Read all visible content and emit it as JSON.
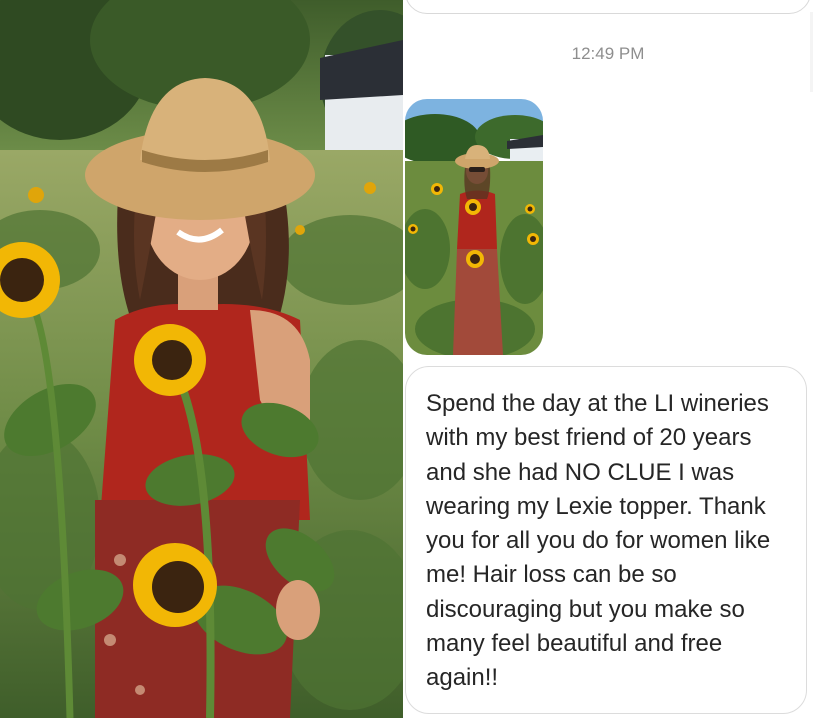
{
  "conversation": {
    "timestamp": "12:49 PM",
    "message_text": "Spend the day at the LI wineries\nwith my best friend of 20 years\nand she had NO CLUE I was\nwearing my Lexie topper. Thank\nyou for all you do for women like\nme! Hair loss can be so\ndiscouraging but you make so\nmany feel beautiful and free\nagain!!"
  },
  "colors": {
    "timestamp_text": "#8e8e8e",
    "message_text": "#262626",
    "bubble_border": "#dcdcdc",
    "foliage": "#5d7f3a",
    "sunflower_petal": "#f2b705",
    "sunflower_center": "#3b2410",
    "dress": "#b0261d",
    "hat": "#cfa56b"
  }
}
